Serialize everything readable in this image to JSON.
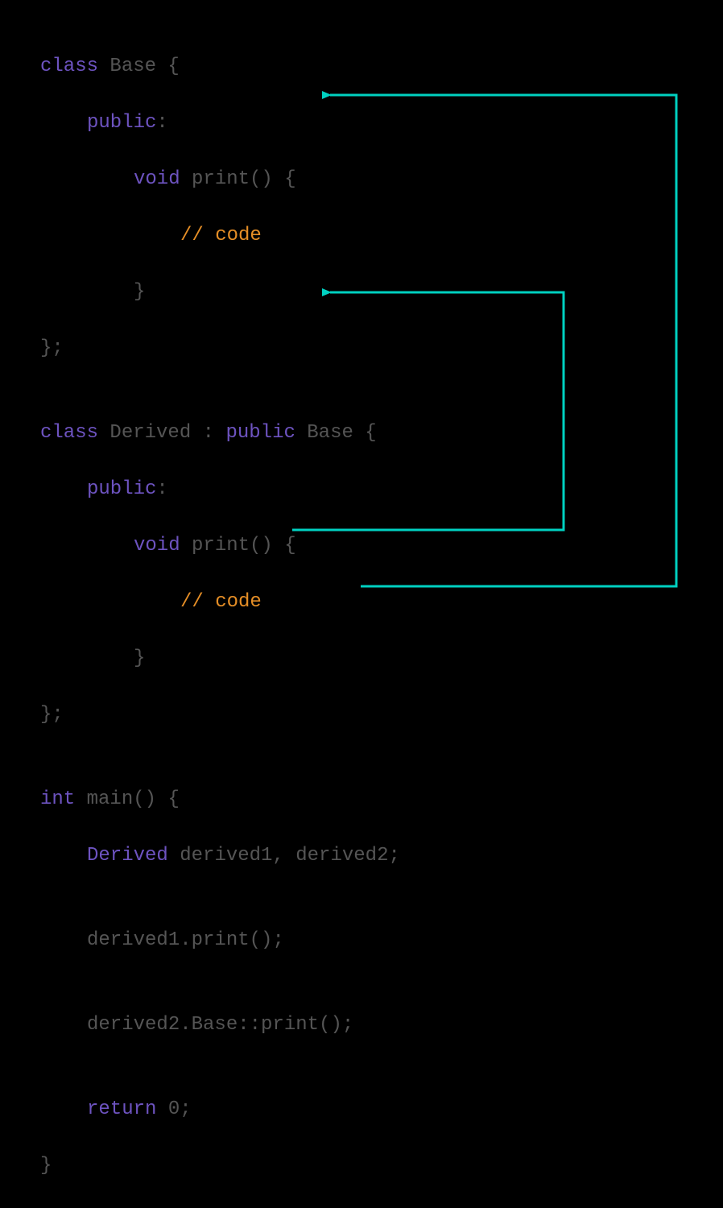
{
  "colors": {
    "background": "#000000",
    "keyword": "#6d53c0",
    "identifier": "#555555",
    "comment": "#e58e26",
    "arrow": "#00d1c1"
  },
  "code": {
    "l1": {
      "kw": "class",
      "rest": " Base {"
    },
    "l2": {
      "kw": "public",
      "rest": ":"
    },
    "l3": {
      "kw": "void",
      "rest": " print() {"
    },
    "l4": {
      "cm": "// code"
    },
    "l5": {
      "rest": "}"
    },
    "l6": {
      "rest": "};"
    },
    "l7": {
      "rest": ""
    },
    "l8": {
      "kw": "class",
      "mid": " Derived : ",
      "kw2": "public",
      "rest": " Base {"
    },
    "l9": {
      "kw": "public",
      "rest": ":"
    },
    "l10": {
      "kw": "void",
      "rest": " print() {"
    },
    "l11": {
      "cm": "// code"
    },
    "l12": {
      "rest": "}"
    },
    "l13": {
      "rest": "};"
    },
    "l14": {
      "rest": ""
    },
    "l15": {
      "kw": "int",
      "rest": " main() {"
    },
    "l16": {
      "kw": "Derived",
      "rest": " derived1, derived2;"
    },
    "l17": {
      "rest": ""
    },
    "l18": {
      "rest": "derived1.print();"
    },
    "l19": {
      "rest": ""
    },
    "l20": {
      "rest": "derived2.Base::print();"
    },
    "l21": {
      "rest": ""
    },
    "l22": {
      "kw": "return",
      "rest": " 0;"
    },
    "l23": {
      "rest": "}"
    }
  },
  "arrows": {
    "a1": {
      "from": "derived1.print()",
      "to": "Derived::print()"
    },
    "a2": {
      "from": "derived2.Base::print()",
      "to": "Base::print()"
    }
  }
}
